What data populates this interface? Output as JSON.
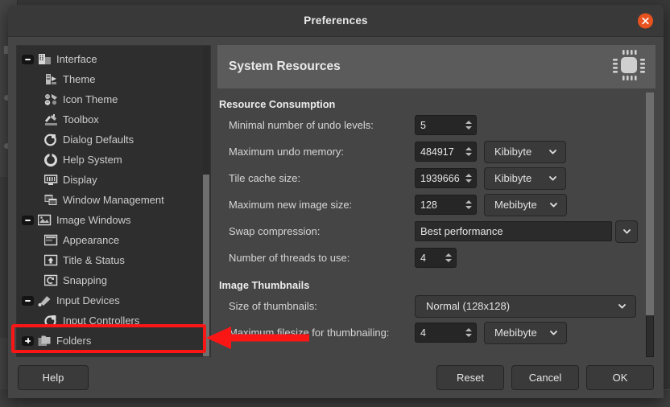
{
  "window": {
    "title": "Preferences",
    "close_icon": "close-icon",
    "accent_close": "#e8521f"
  },
  "sidebar": {
    "items": [
      {
        "label": "Interface",
        "level": 0,
        "expander": "minus",
        "icon": "interface-icon"
      },
      {
        "label": "Theme",
        "level": 1,
        "expander": "none",
        "icon": "theme-icon"
      },
      {
        "label": "Icon Theme",
        "level": 1,
        "expander": "none",
        "icon": "icon-theme-icon"
      },
      {
        "label": "Toolbox",
        "level": 1,
        "expander": "none",
        "icon": "toolbox-icon"
      },
      {
        "label": "Dialog Defaults",
        "level": 1,
        "expander": "none",
        "icon": "dialog-defaults-icon"
      },
      {
        "label": "Help System",
        "level": 1,
        "expander": "none",
        "icon": "help-system-icon"
      },
      {
        "label": "Display",
        "level": 1,
        "expander": "none",
        "icon": "display-icon"
      },
      {
        "label": "Window Management",
        "level": 1,
        "expander": "none",
        "icon": "window-management-icon"
      },
      {
        "label": "Image Windows",
        "level": 0,
        "expander": "minus",
        "icon": "image-windows-icon"
      },
      {
        "label": "Appearance",
        "level": 1,
        "expander": "none",
        "icon": "appearance-icon"
      },
      {
        "label": "Title & Status",
        "level": 1,
        "expander": "none",
        "icon": "title-status-icon"
      },
      {
        "label": "Snapping",
        "level": 1,
        "expander": "none",
        "icon": "snapping-icon"
      },
      {
        "label": "Input Devices",
        "level": 0,
        "expander": "minus",
        "icon": "input-devices-icon"
      },
      {
        "label": "Input Controllers",
        "level": 1,
        "expander": "none",
        "icon": "input-controllers-icon"
      },
      {
        "label": "Folders",
        "level": 0,
        "expander": "plus",
        "icon": "folders-icon"
      }
    ]
  },
  "page": {
    "title": "System Resources",
    "header_icon": "cpu-chip-icon",
    "sections": [
      {
        "title": "Resource Consumption",
        "rows": [
          {
            "label": "Minimal number of undo levels:",
            "control": "spin",
            "value": "5"
          },
          {
            "label": "Maximum undo memory:",
            "control": "spin+combo",
            "value": "484917",
            "unit": "Kibibyte"
          },
          {
            "label": "Tile cache size:",
            "control": "spin+combo",
            "value": "1939666",
            "unit": "Kibibyte"
          },
          {
            "label": "Maximum new image size:",
            "control": "spin+combo",
            "value": "128",
            "unit": "Mebibyte"
          },
          {
            "label": "Swap compression:",
            "control": "combo-flat",
            "value": "Best performance"
          },
          {
            "label": "Number of threads to use:",
            "control": "spin-narrow",
            "value": "4"
          }
        ]
      },
      {
        "title": "Image Thumbnails",
        "rows": [
          {
            "label": "Size of thumbnails:",
            "control": "combo-wide",
            "value": "Normal (128x128)"
          },
          {
            "label": "Maximum filesize for thumbnailing:",
            "control": "spin+combo",
            "value": "4",
            "unit": "Mebibyte"
          }
        ]
      }
    ]
  },
  "footer": {
    "help": "Help",
    "reset": "Reset",
    "cancel": "Cancel",
    "ok": "OK"
  },
  "annotation": {
    "color": "#fb1616",
    "target": "Folders",
    "box_name": "highlight-box",
    "arrow_name": "pointer-arrow"
  }
}
